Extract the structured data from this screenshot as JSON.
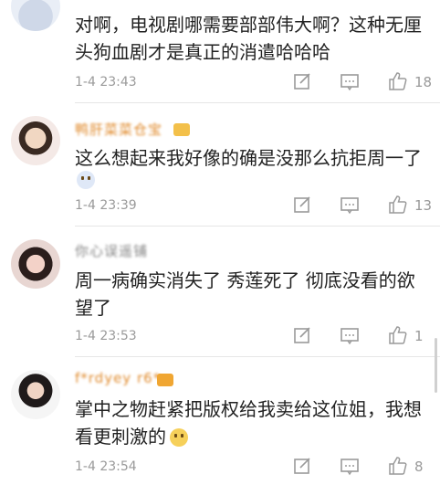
{
  "comments": [
    {
      "username": "",
      "text": "对啊，电视剧哪需要部部伟大啊？这种无厘头狗血剧才是真正的消遣哈哈哈",
      "time": "1-4 23:43",
      "likes": "18"
    },
    {
      "username": "鸭肝菜菜仓宝",
      "text": "这么想起来我好像的确是没那么抗拒周一了",
      "time": "1-4 23:39",
      "likes": "13"
    },
    {
      "username": "你心误遥铺",
      "text": "周一病确实消失了 秀莲死了 彻底没看的欲望了",
      "time": "1-4 23:53",
      "likes": "1"
    },
    {
      "username": "f*rdyey r6*",
      "text": "掌中之物赶紧把版权给我卖给这位姐，我想看更刺激的",
      "time": "1-4 23:54",
      "likes": "8"
    }
  ]
}
